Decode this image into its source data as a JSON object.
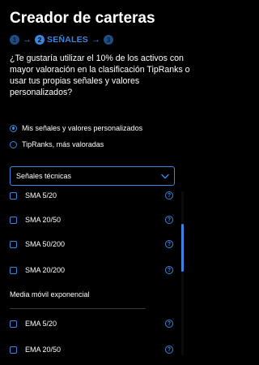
{
  "header": {
    "title": "Creador de carteras"
  },
  "stepper": {
    "step1": "1",
    "step2": "2",
    "step3": "3",
    "arrow": "→",
    "current_label": "SEÑALES"
  },
  "question": "¿Te gustaría utilizar el 10% de los activos con mayor valoración en la clasificación TipRanks o usar tus propias señales y valores personalizados?",
  "options": [
    {
      "label": "Mis señales y valores personalizados",
      "selected": true
    },
    {
      "label": "TipRanks, más valoradas",
      "selected": false
    }
  ],
  "dropdown": {
    "selected": "Señales técnicas"
  },
  "technical_signals": [
    {
      "label": "SMA 5/20",
      "checked": false
    },
    {
      "label": "SMA 20/50",
      "checked": false
    },
    {
      "label": "SMA 50/200",
      "checked": false
    },
    {
      "label": "SMA 20/200",
      "checked": false
    }
  ],
  "ema_section": {
    "heading": "Media móvil exponencial",
    "items": [
      {
        "label": "EMA 5/20",
        "checked": false
      },
      {
        "label": "EMA 20/50",
        "checked": false
      }
    ]
  },
  "help_glyph": "?",
  "colors": {
    "background": "#000000",
    "accent": "#3a86e0",
    "inactive_step": "#1d4f86",
    "text": "#ffffff"
  }
}
